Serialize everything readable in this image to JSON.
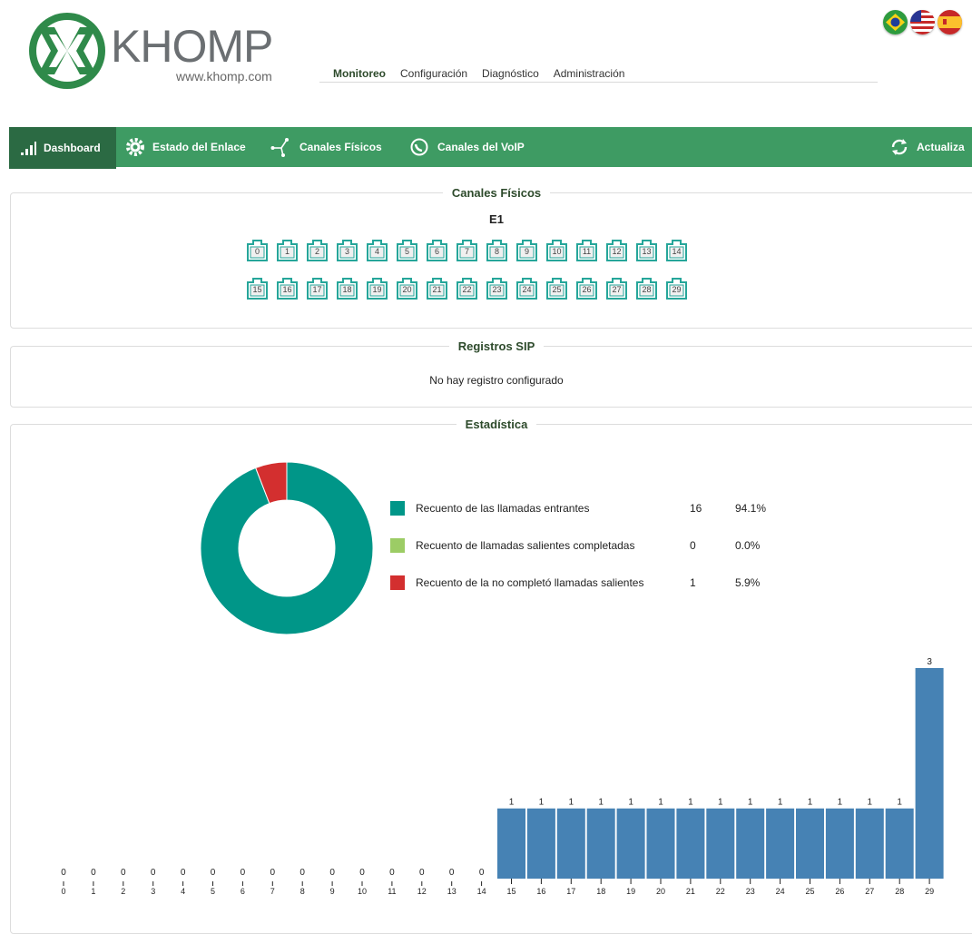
{
  "header": {
    "logo_text": "KHOMP",
    "logo_url": "www.khomp.com",
    "nav": [
      "Monitoreo",
      "Configuración",
      "Diagnóstico",
      "Administración"
    ]
  },
  "flags": [
    "brazil-flag-icon",
    "usa-flag-icon",
    "spain-flag-icon"
  ],
  "toolbar": {
    "dashboard": "Dashboard",
    "estado_enlace": "Estado del Enlace",
    "canales_fisicos": "Canales Físicos",
    "canales_voip": "Canales del VoIP",
    "actualizar": "Actualiza"
  },
  "canales_panel": {
    "title": "Canales Físicos",
    "span_label": "E1",
    "row1": [
      "0",
      "1",
      "2",
      "3",
      "4",
      "5",
      "6",
      "7",
      "8",
      "9",
      "10",
      "11",
      "12",
      "13",
      "14"
    ],
    "row2": [
      "15",
      "16",
      "17",
      "18",
      "19",
      "20",
      "21",
      "22",
      "23",
      "24",
      "25",
      "26",
      "27",
      "28",
      "29"
    ]
  },
  "sip_panel": {
    "title": "Registros SIP",
    "message": "No hay registro configurado"
  },
  "stats_panel": {
    "title": "Estadística",
    "legend": [
      {
        "label": "Recuento de las llamadas entrantes",
        "count": "16",
        "percent": "94.1%",
        "color": "#009688"
      },
      {
        "label": "Recuento de llamadas salientes completadas",
        "count": "0",
        "percent": "0.0%",
        "color": "#9ccc65"
      },
      {
        "label": "Recuento de la no completó llamadas salientes",
        "count": "1",
        "percent": "5.9%",
        "color": "#d32f2f"
      }
    ]
  },
  "colors": {
    "green_bar": "#3e9b63",
    "green_active": "#2b6a43",
    "port_teal": "#26a69a",
    "bar_blue": "#4682b4"
  },
  "chart_data": [
    {
      "type": "pie",
      "variant": "donut",
      "categories": [
        "Recuento de las llamadas entrantes",
        "Recuento de llamadas salientes completadas",
        "Recuento de la no completó llamadas salientes"
      ],
      "values": [
        16,
        0,
        1
      ],
      "colors": [
        "#009688",
        "#9ccc65",
        "#d32f2f"
      ]
    },
    {
      "type": "bar",
      "categories": [
        "0",
        "1",
        "2",
        "3",
        "4",
        "5",
        "6",
        "7",
        "8",
        "9",
        "10",
        "11",
        "12",
        "13",
        "14",
        "15",
        "16",
        "17",
        "18",
        "19",
        "20",
        "21",
        "22",
        "23",
        "24",
        "25",
        "26",
        "27",
        "28",
        "29"
      ],
      "values": [
        0,
        0,
        0,
        0,
        0,
        0,
        0,
        0,
        0,
        0,
        0,
        0,
        0,
        0,
        0,
        1,
        1,
        1,
        1,
        1,
        1,
        1,
        1,
        1,
        1,
        1,
        1,
        1,
        1,
        3
      ],
      "ylim": [
        0,
        3
      ],
      "color": "#4682b4",
      "data_labels": true,
      "grid": false
    }
  ]
}
